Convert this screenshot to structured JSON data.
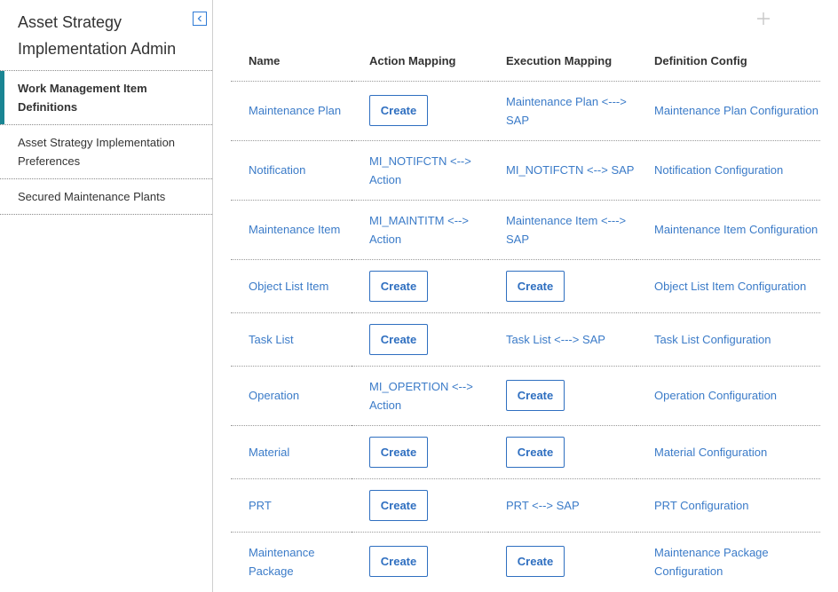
{
  "sidebar": {
    "title": "Asset Strategy Implementation Admin",
    "collapse_icon": "chevron-left-icon",
    "items": [
      {
        "label": "Work Management Item Definitions",
        "active": true
      },
      {
        "label": "Asset Strategy Implementation Preferences",
        "active": false
      },
      {
        "label": "Secured Maintenance Plants",
        "active": false
      }
    ]
  },
  "main": {
    "add_icon": "plus-icon",
    "create_label": "Create",
    "columns": [
      "Name",
      "Action Mapping",
      "Execution Mapping",
      "Definition Config"
    ],
    "rows": [
      {
        "name": "Maintenance Plan",
        "action": null,
        "execution": "Maintenance Plan <---> SAP",
        "config": "Maintenance Plan Configuration"
      },
      {
        "name": "Notification",
        "action": "MI_NOTIFCTN <--> Action",
        "execution": "MI_NOTIFCTN <--> SAP",
        "config": "Notification Configuration"
      },
      {
        "name": "Maintenance Item",
        "action": "MI_MAINTITM <--> Action",
        "execution": "Maintenance Item <---> SAP",
        "config": "Maintenance Item Configuration"
      },
      {
        "name": "Object List Item",
        "action": null,
        "execution": null,
        "config": "Object List Item Configuration"
      },
      {
        "name": "Task List",
        "action": null,
        "execution": "Task List <---> SAP",
        "config": "Task List Configuration"
      },
      {
        "name": "Operation",
        "action": "MI_OPERTION <--> Action",
        "execution": null,
        "config": "Operation Configuration"
      },
      {
        "name": "Material",
        "action": null,
        "execution": null,
        "config": "Material Configuration"
      },
      {
        "name": "PRT",
        "action": null,
        "execution": "PRT <--> SAP",
        "config": "PRT Configuration"
      },
      {
        "name": "Maintenance Package",
        "action": null,
        "execution": null,
        "config": "Maintenance Package Configuration"
      }
    ]
  },
  "colors": {
    "link": "#3b7bc8",
    "button_border": "#2f6fc0",
    "active_indicator": "#1a8593"
  }
}
